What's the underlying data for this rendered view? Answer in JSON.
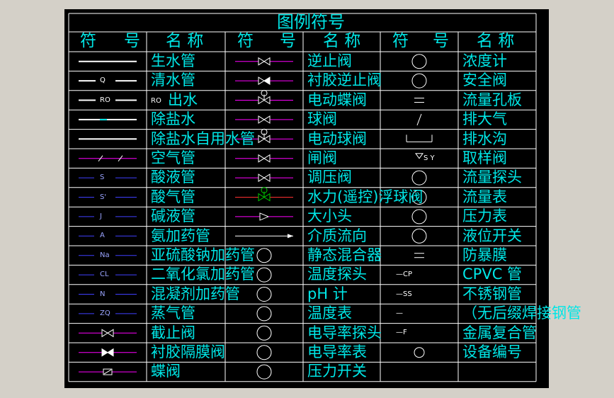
{
  "title": "图例符号",
  "headers": {
    "sym1_a": "符",
    "sym1_b": "号",
    "name1": "名  称",
    "sym2_a": "符",
    "sym2_b": "号",
    "name2": "名  称",
    "sym3_a": "符",
    "sym3_b": "号",
    "name3": "名  称"
  },
  "col1_names": [
    "生水管",
    "清水管",
    "出水",
    "除盐水",
    "除盐水自用水管",
    "空气管",
    "酸液管",
    "酸气管",
    "碱液管",
    "氨加药管",
    "亚硫酸钠加药管",
    "二氧化氯加药管",
    "混凝剂加药管",
    "蒸气管",
    "截止阀",
    "衬胶隔膜阀",
    "蝶阀"
  ],
  "col1_codes": [
    "",
    "Q",
    "RO",
    "",
    "",
    "",
    "S",
    "S'",
    "J",
    "A",
    "Na",
    "CL",
    "N",
    "ZQ",
    "",
    "",
    ""
  ],
  "col2_names": [
    "逆止阀",
    "衬胶逆止阀",
    "电动蝶阀",
    "球阀",
    "电动球阀",
    "闸阀",
    "调压阀",
    "水力(遥控)浮球阀",
    "大小头",
    "介质流向",
    "静态混合器",
    "温度探头",
    "pH 计",
    "温度表",
    "电导率探头",
    "电导率表",
    "压力开关"
  ],
  "col3_names": [
    "浓度计",
    "安全阀",
    "流量孔板",
    "排大气",
    "排水沟",
    "取样阀",
    "流量探头",
    "流量表",
    "压力表",
    "液位开关",
    "防暴膜",
    "CPVC 管",
    "不锈钢管",
    "（无后缀焊接钢管",
    "金属复合管",
    "设备编号",
    ""
  ],
  "col3_codes": [
    "",
    "",
    "",
    "",
    "",
    "",
    "",
    "",
    "",
    "",
    "",
    "—CP",
    "—SS",
    "—",
    "—F",
    "",
    ""
  ],
  "row1_prefix": "RO",
  "col3_misc": {
    "sampling_code": "S Y",
    "ph_prefix": "pH"
  },
  "colors": {
    "cyan": "#00e6e6",
    "magenta": "#ff00ff",
    "blue": "#4040ff",
    "white": "#ffffff",
    "green": "#00cc00",
    "red": "#ff3030",
    "background": "#000000"
  }
}
